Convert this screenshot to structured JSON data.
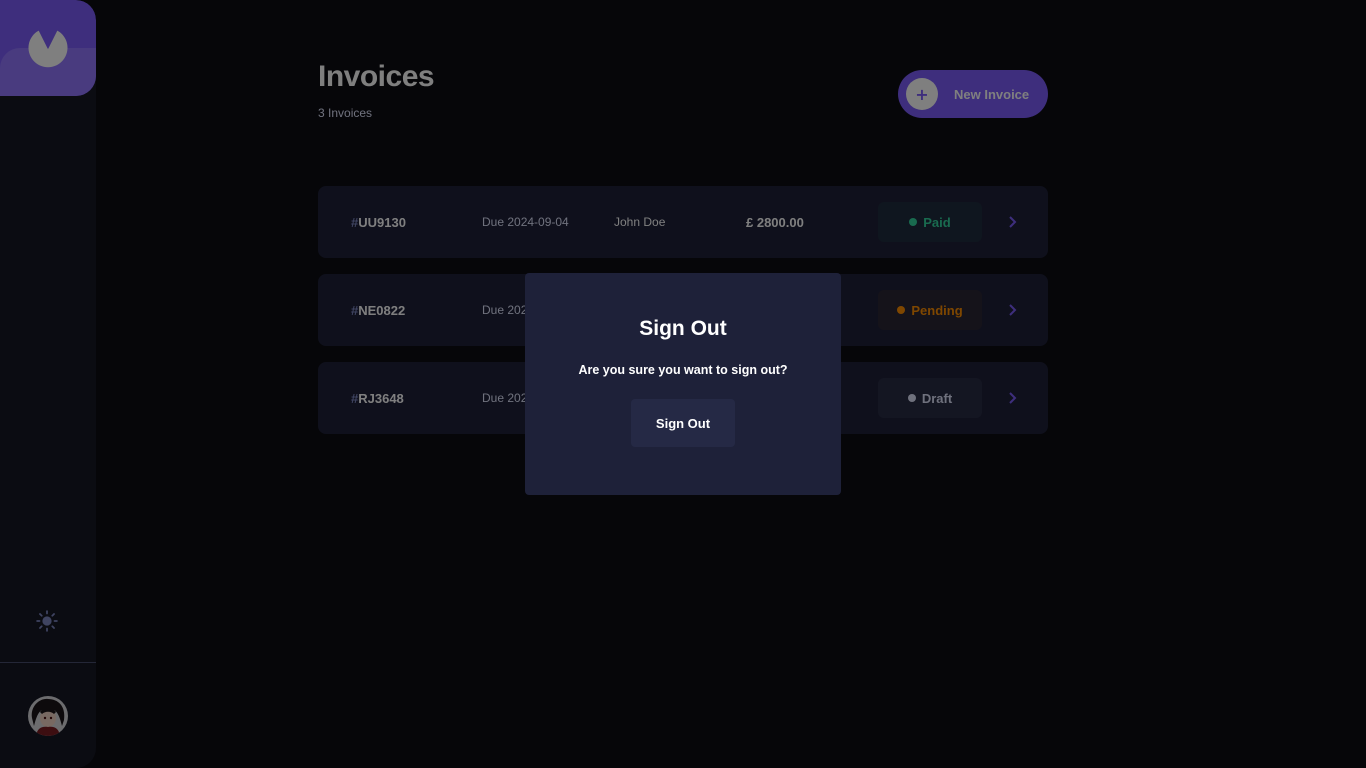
{
  "header": {
    "title": "Invoices",
    "subtitle": "3 Invoices",
    "new_invoice_label": "New Invoice",
    "new_invoice_icon": "plus-icon"
  },
  "invoices": [
    {
      "hash": "#",
      "id": "UU9130",
      "due": "Due 2024-09-04",
      "client": "John Doe",
      "amount": "£ 2800.00",
      "status": "Paid"
    },
    {
      "hash": "#",
      "id": "NE0822",
      "due": "Due 202",
      "client": "",
      "amount": "",
      "status": "Pending"
    },
    {
      "hash": "#",
      "id": "RJ3648",
      "due": "Due 202",
      "client": "",
      "amount": "",
      "status": "Draft"
    }
  ],
  "modal": {
    "title": "Sign Out",
    "message": "Are you sure you want to sign out?",
    "confirm_label": "Sign Out"
  },
  "sidebar": {
    "logo_icon": "logo-icon",
    "theme_icon": "sun-icon",
    "avatar": "user-avatar"
  },
  "colors": {
    "accent": "#7c5dfa",
    "accent_light": "#9277ff",
    "paid": "#33d69f",
    "pending": "#ff8f00",
    "draft": "#dfe3fa",
    "card": "#1e2139",
    "background": "#141625"
  }
}
